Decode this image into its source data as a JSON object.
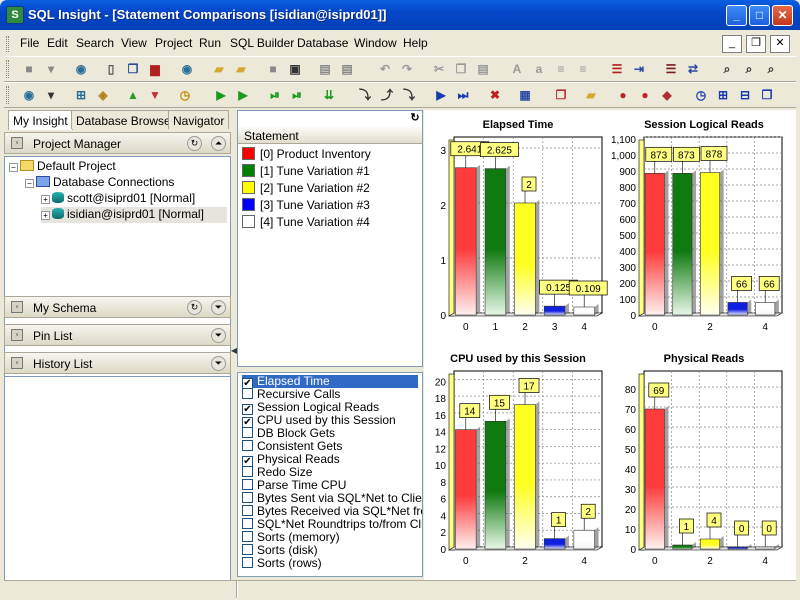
{
  "window": {
    "title": "SQL Insight - [Statement Comparisons [isidian@isiprd01]]",
    "app_icon": "S"
  },
  "menu": [
    "File",
    "Edit",
    "Search",
    "View",
    "Project",
    "Run",
    "SQL Builder",
    "Database",
    "Window",
    "Help"
  ],
  "toolbar1": [
    {
      "x": 6,
      "icon": "stop-icon",
      "g": "■",
      "c": "#888"
    },
    {
      "x": 28,
      "icon": "dropdown-icon",
      "g": "▾",
      "c": "#888"
    },
    {
      "x": 58,
      "icon": "database-icon",
      "g": "◉",
      "c": "#2a6f9a"
    },
    {
      "x": 88,
      "icon": "new-file-icon",
      "g": "▯",
      "c": "#555"
    },
    {
      "x": 110,
      "icon": "copy-windows-icon",
      "g": "❐",
      "c": "#2b4aa0"
    },
    {
      "x": 132,
      "icon": "chart-icon",
      "g": "▆",
      "c": "#b02020"
    },
    {
      "x": 164,
      "icon": "database-add-icon",
      "g": "◉",
      "c": "#2a6f9a"
    },
    {
      "x": 196,
      "icon": "open-folder-icon",
      "g": "▰",
      "c": "#d6a630"
    },
    {
      "x": 218,
      "icon": "folder-icon",
      "g": "▰",
      "c": "#d6a630"
    },
    {
      "x": 250,
      "icon": "save-icon",
      "g": "■",
      "c": "#888"
    },
    {
      "x": 272,
      "icon": "save-all-icon",
      "g": "▣",
      "c": "#333"
    },
    {
      "x": 302,
      "icon": "print-icon",
      "g": "▤",
      "c": "#888"
    },
    {
      "x": 324,
      "icon": "print-preview-icon",
      "g": "▤",
      "c": "#888"
    },
    {
      "x": 362,
      "icon": "undo-icon",
      "g": "↶",
      "c": "#999"
    },
    {
      "x": 384,
      "icon": "redo-icon",
      "g": "↷",
      "c": "#999"
    },
    {
      "x": 416,
      "icon": "cut-icon",
      "g": "✂",
      "c": "#999"
    },
    {
      "x": 438,
      "icon": "copy-icon",
      "g": "❐",
      "c": "#999"
    },
    {
      "x": 460,
      "icon": "paste-icon",
      "g": "▤",
      "c": "#999"
    },
    {
      "x": 494,
      "icon": "uppercase-icon",
      "g": "A",
      "c": "#999"
    },
    {
      "x": 516,
      "icon": "lowercase-icon",
      "g": "a",
      "c": "#999"
    },
    {
      "x": 538,
      "icon": "indent-icon",
      "g": "≡",
      "c": "#999"
    },
    {
      "x": 560,
      "icon": "outdent-icon",
      "g": "≡",
      "c": "#999"
    },
    {
      "x": 594,
      "icon": "list-red-icon",
      "g": "☰",
      "c": "#b02020"
    },
    {
      "x": 616,
      "icon": "align-icon",
      "g": "⇥",
      "c": "#2b4aa0"
    },
    {
      "x": 648,
      "icon": "list-icon",
      "g": "☰",
      "c": "#7a1a1a"
    },
    {
      "x": 670,
      "icon": "compare-icon",
      "g": "⇄",
      "c": "#2b4aa0"
    },
    {
      "x": 704,
      "icon": "find-icon",
      "g": "⌕",
      "c": "#333"
    },
    {
      "x": 726,
      "icon": "replace-icon",
      "g": "⌕",
      "c": "#333"
    },
    {
      "x": 748,
      "icon": "find-next-icon",
      "g": "⌕",
      "c": "#333"
    }
  ],
  "toolbar2": [
    {
      "x": 6,
      "icon": "connect-icon",
      "g": "◉",
      "c": "#2a6f9a"
    },
    {
      "x": 28,
      "icon": "dropdown-icon",
      "g": "▾",
      "c": "#333"
    },
    {
      "x": 58,
      "icon": "tree-icon",
      "g": "⊞",
      "c": "#2a6f9a"
    },
    {
      "x": 80,
      "icon": "object-browser-icon",
      "g": "◈",
      "c": "#b0801a"
    },
    {
      "x": 110,
      "icon": "commit-icon",
      "g": "▲",
      "c": "#2a9a2a"
    },
    {
      "x": 132,
      "icon": "rollback-icon",
      "g": "▼",
      "c": "#c03030"
    },
    {
      "x": 162,
      "icon": "clock-icon",
      "g": "◷",
      "c": "#c08a00"
    },
    {
      "x": 198,
      "icon": "run-icon",
      "g": "▶",
      "c": "#1a9a1a"
    },
    {
      "x": 220,
      "icon": "run-to-cursor-icon",
      "g": "▶",
      "c": "#1a9a1a"
    },
    {
      "x": 252,
      "icon": "step-icon",
      "g": "⏯",
      "c": "#1a9a1a"
    },
    {
      "x": 274,
      "icon": "step-over-icon",
      "g": "⏯",
      "c": "#1a9a1a"
    },
    {
      "x": 306,
      "icon": "execute-all-icon",
      "g": "⇊",
      "c": "#1a9a1a"
    },
    {
      "x": 342,
      "icon": "step-into-icon",
      "g": "⤵",
      "c": "#333"
    },
    {
      "x": 364,
      "icon": "step-out-icon",
      "g": "⤴",
      "c": "#333"
    },
    {
      "x": 386,
      "icon": "step-next-icon",
      "g": "⤵",
      "c": "#333"
    },
    {
      "x": 418,
      "icon": "play-blue-icon",
      "g": "▶",
      "c": "#1a3ab0"
    },
    {
      "x": 440,
      "icon": "play-to-end-icon",
      "g": "⏭",
      "c": "#1a3ab0"
    },
    {
      "x": 472,
      "icon": "cancel-icon",
      "g": "✖",
      "c": "#c02020"
    },
    {
      "x": 502,
      "icon": "properties-icon",
      "g": "▦",
      "c": "#2b4aa0"
    },
    {
      "x": 538,
      "icon": "windows-icon",
      "g": "❐",
      "c": "#b03030"
    },
    {
      "x": 568,
      "icon": "open-project-icon",
      "g": "▰",
      "c": "#d6a630"
    },
    {
      "x": 600,
      "icon": "breakpoint-icon",
      "g": "●",
      "c": "#c02020"
    },
    {
      "x": 622,
      "icon": "clear-breakpoints-icon",
      "g": "●",
      "c": "#c02020"
    },
    {
      "x": 644,
      "icon": "watch-icon",
      "g": "◆",
      "c": "#b03030"
    },
    {
      "x": 678,
      "icon": "history-clock-icon",
      "g": "◷",
      "c": "#1a3ab0"
    },
    {
      "x": 700,
      "icon": "explain-plan-icon",
      "g": "⊞",
      "c": "#1a3ab0"
    },
    {
      "x": 722,
      "icon": "tile-icon",
      "g": "⊟",
      "c": "#1a3ab0"
    },
    {
      "x": 744,
      "icon": "cascade-icon",
      "g": "❐",
      "c": "#1a3ab0"
    }
  ],
  "left_tabs": [
    "My Insight",
    "Database Browser",
    "Navigator"
  ],
  "panels": {
    "project_manager": "Project Manager",
    "my_schema": "My Schema",
    "pin_list": "Pin List",
    "history_list": "History List"
  },
  "tree": {
    "root": "Default Project",
    "connections": "Database Connections",
    "items": [
      "scott@isiprd01 [Normal]",
      "isidian@isiprd01 [Normal]"
    ]
  },
  "statements": {
    "header": "Statement",
    "items": [
      {
        "label": "[0] Product Inventory",
        "color": "#ff0000"
      },
      {
        "label": "[1] Tune Variation #1",
        "color": "#008000"
      },
      {
        "label": "[2] Tune Variation #2",
        "color": "#ffff00"
      },
      {
        "label": "[3] Tune Variation #3",
        "color": "#0000ff"
      },
      {
        "label": "[4] Tune Variation #4",
        "color": "#ffffff"
      }
    ]
  },
  "metrics": [
    {
      "label": "Elapsed Time",
      "checked": true,
      "selected": true
    },
    {
      "label": "Recursive Calls",
      "checked": false
    },
    {
      "label": "Session Logical Reads",
      "checked": true
    },
    {
      "label": "CPU used by this Session",
      "checked": true
    },
    {
      "label": "DB Block Gets",
      "checked": false
    },
    {
      "label": "Consistent Gets",
      "checked": false
    },
    {
      "label": "Physical Reads",
      "checked": true
    },
    {
      "label": "Redo Size",
      "checked": false
    },
    {
      "label": "Parse Time CPU",
      "checked": false
    },
    {
      "label": "Bytes Sent via SQL*Net to Client",
      "checked": false
    },
    {
      "label": "Bytes Received via SQL*Net from",
      "checked": false
    },
    {
      "label": "SQL*Net Roundtrips to/from Client",
      "checked": false
    },
    {
      "label": "Sorts (memory)",
      "checked": false
    },
    {
      "label": "Sorts (disk)",
      "checked": false
    },
    {
      "label": "Sorts (rows)",
      "checked": false
    }
  ],
  "chart_data": [
    {
      "type": "bar",
      "title": "Elapsed Time",
      "categories": [
        "0",
        "1",
        "2",
        "3",
        "4"
      ],
      "values": [
        2.641,
        2.625,
        2,
        0.125,
        0.109
      ],
      "labels": [
        "2.641",
        "2.625",
        "2",
        "0.125",
        "0.109"
      ],
      "ylim": [
        0,
        3.2
      ],
      "yticks": [
        0,
        1,
        2,
        3
      ],
      "xticks": [
        "0",
        "1",
        "2",
        "3",
        "4"
      ],
      "grid": true,
      "colors": [
        "#ff0000",
        "#008000",
        "#ffff00",
        "#0000ff",
        "#ffffff"
      ]
    },
    {
      "type": "bar",
      "title": "Session Logical Reads",
      "categories": [
        "0",
        "1",
        "2",
        "3",
        "4"
      ],
      "values": [
        873,
        873,
        878,
        66,
        66
      ],
      "labels": [
        "873",
        "873",
        "878",
        "66",
        "66"
      ],
      "ylim": [
        0,
        1100
      ],
      "yticks": [
        0,
        100,
        200,
        300,
        400,
        500,
        600,
        700,
        800,
        900,
        1000,
        1100
      ],
      "ytick_labels": [
        "0",
        "100",
        "200",
        "300",
        "400",
        "500",
        "600",
        "700",
        "800",
        "900",
        "1,000",
        "1,100"
      ],
      "xticks": [
        "0",
        "",
        "2",
        "",
        "4"
      ],
      "grid": true,
      "colors": [
        "#ff0000",
        "#008000",
        "#ffff00",
        "#0000ff",
        "#ffffff"
      ]
    },
    {
      "type": "bar",
      "title": "CPU used by this Session",
      "categories": [
        "0",
        "1",
        "2",
        "3",
        "4"
      ],
      "values": [
        14,
        15,
        17,
        1,
        2
      ],
      "labels": [
        "14",
        "15",
        "17",
        "1",
        "2"
      ],
      "ylim": [
        0,
        21
      ],
      "yticks": [
        0,
        2,
        4,
        6,
        8,
        10,
        12,
        14,
        16,
        18,
        20
      ],
      "xticks": [
        "0",
        "",
        "2",
        "",
        "4"
      ],
      "grid": true,
      "colors": [
        "#ff0000",
        "#008000",
        "#ffff00",
        "#0000ff",
        "#ffffff"
      ]
    },
    {
      "type": "bar",
      "title": "Physical Reads",
      "categories": [
        "0",
        "1",
        "2",
        "3",
        "4"
      ],
      "values": [
        69,
        1,
        4,
        0,
        0
      ],
      "labels": [
        "69",
        "1",
        "4",
        "0",
        "0"
      ],
      "ylim": [
        0,
        88
      ],
      "yticks": [
        0,
        10,
        20,
        30,
        40,
        50,
        60,
        70,
        80
      ],
      "xticks": [
        "0",
        "",
        "2",
        "",
        "4"
      ],
      "grid": true,
      "colors": [
        "#ff0000",
        "#008000",
        "#ffff00",
        "#0000ff",
        "#ffffff"
      ]
    }
  ]
}
